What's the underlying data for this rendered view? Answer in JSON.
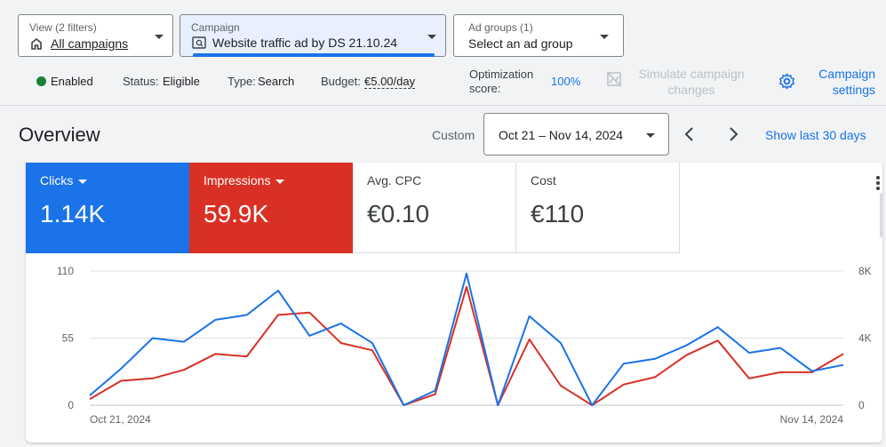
{
  "filters": {
    "view": {
      "label": "View (2 filters)",
      "value": "All campaigns"
    },
    "campaign": {
      "label": "Campaign",
      "value": "Website traffic ad by DS 21.10.24"
    },
    "ad_groups": {
      "label": "Ad groups (1)",
      "value": "Select an ad group"
    }
  },
  "status_bar": {
    "enabled": "Enabled",
    "status_label": "Status:",
    "status_value": "Eligible",
    "type_label": "Type:",
    "type_value": "Search",
    "budget_label": "Budget:",
    "budget_value": "€5.00/day",
    "optimization_label_1": "Optimization",
    "optimization_label_2": "score:",
    "optimization_value": "100%",
    "simulate_1": "Simulate campaign",
    "simulate_2": "changes",
    "settings_1": "Campaign",
    "settings_2": "settings",
    "enabled_color": "#188038",
    "accent_color": "#1a73e8"
  },
  "overview": {
    "title": "Overview",
    "range_label": "Custom",
    "date_range": "Oct 21 – Nov 14, 2024",
    "show_last": "Show last 30 days"
  },
  "metrics": [
    {
      "name": "Clicks",
      "value": "1.14K",
      "color": "#1a73e8",
      "selected": true
    },
    {
      "name": "Impressions",
      "value": "59.9K",
      "color": "#d93025",
      "selected": true
    },
    {
      "name": "Avg. CPC",
      "value": "€0.10",
      "selected": false
    },
    {
      "name": "Cost",
      "value": "€110",
      "selected": false
    }
  ],
  "chart_data": {
    "type": "line",
    "x_start_label": "Oct 21, 2024",
    "x_end_label": "Nov 14, 2024",
    "left_axis": {
      "ticks": [
        "110",
        "55",
        "0"
      ],
      "ylim": [
        0,
        110
      ]
    },
    "right_axis": {
      "ticks": [
        "8K",
        "4K",
        "0"
      ],
      "ylim": [
        0,
        8000
      ]
    },
    "grid": true,
    "series": [
      {
        "name": "Clicks",
        "axis": "left",
        "color": "#1a73e8",
        "values": [
          8,
          30,
          55,
          52,
          70,
          74,
          94,
          57,
          67,
          51,
          0,
          12,
          108,
          0,
          73,
          51,
          0,
          34,
          38,
          49,
          64,
          43,
          47,
          28,
          33
        ]
      },
      {
        "name": "Impressions",
        "axis": "left",
        "color": "#d93025",
        "values": [
          5,
          20,
          22,
          29,
          42,
          40,
          74,
          76,
          51,
          45,
          0,
          9,
          97,
          0,
          54,
          16,
          0,
          17,
          23,
          41,
          53,
          22,
          27,
          27,
          42
        ]
      }
    ]
  }
}
